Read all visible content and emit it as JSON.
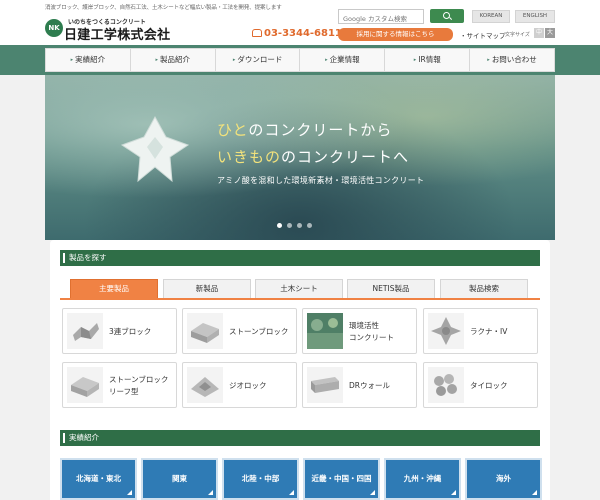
{
  "header": {
    "tagline": "消波ブロック、護岸ブロック、自然石工法、土木シートなど幅広い製品・工法を開発、提案します",
    "logo_sub": "いのちをつくるコンクリート",
    "logo_name": "日建工学株式会社",
    "logo_mark": "NK",
    "search_placeholder": "Google カスタム検索",
    "lang_korean": "KOREAN",
    "lang_english": "ENGLISH",
    "phone": "03-3344-6811",
    "recruit_label": "採用に関する情報はこちら",
    "sitemap_label": "・サイトマップ",
    "fontsize_label": "文字サイズ",
    "fontsize_mid": "中",
    "fontsize_large": "大"
  },
  "nav": {
    "items": [
      {
        "label": "実績紹介"
      },
      {
        "label": "製品紹介"
      },
      {
        "label": "ダウンロード"
      },
      {
        "label": "企業情報"
      },
      {
        "label": "IR情報"
      },
      {
        "label": "お問い合わせ"
      }
    ]
  },
  "hero": {
    "line1_accent": "ひと",
    "line1_rest": "のコンクリートから",
    "line2_accent": "いきもの",
    "line2_rest": "のコンクリートへ",
    "subtitle": "アミノ酸を混和した環境新素材・環境活性コンクリート",
    "slide_count": 4,
    "active_slide": 1
  },
  "products": {
    "heading": "製品を探す",
    "tabs": [
      {
        "label": "主要製品",
        "active": true
      },
      {
        "label": "新製品",
        "active": false
      },
      {
        "label": "土木シート",
        "active": false
      },
      {
        "label": "NETIS製品",
        "active": false
      },
      {
        "label": "製品検索",
        "active": false
      }
    ],
    "cards": [
      {
        "label_line1": "3連ブロック",
        "label_line2": "",
        "icon": "triple-block-icon"
      },
      {
        "label_line1": "ストーンブロック",
        "label_line2": "",
        "icon": "stone-block-icon"
      },
      {
        "label_line1": "環境活性",
        "label_line2": "コンクリート",
        "icon": "eco-concrete-photo"
      },
      {
        "label_line1": "ラクナ・IV",
        "label_line2": "",
        "icon": "lacuna-block-icon"
      },
      {
        "label_line1": "ストーンブロック",
        "label_line2": "リーフ型",
        "icon": "stone-block-leaf-icon"
      },
      {
        "label_line1": "ジオロック",
        "label_line2": "",
        "icon": "geolock-icon"
      },
      {
        "label_line1": "DRウォール",
        "label_line2": "",
        "icon": "dr-wall-icon"
      },
      {
        "label_line1": "タイロック",
        "label_line2": "",
        "icon": "tielock-icon"
      }
    ]
  },
  "results": {
    "heading": "実績紹介",
    "regions": [
      {
        "label": "北海道・東北"
      },
      {
        "label": "関東"
      },
      {
        "label": "北陸・中部"
      },
      {
        "label": "近畿・中国・四国"
      },
      {
        "label": "九州・沖縄"
      },
      {
        "label": "海外"
      }
    ]
  },
  "colors": {
    "brand_green": "#2f6e47",
    "nav_band": "#4c8470",
    "accent_orange": "#f08244",
    "region_blue": "#2f7bb5",
    "hero_accent_yellow": "#f2e27c"
  }
}
